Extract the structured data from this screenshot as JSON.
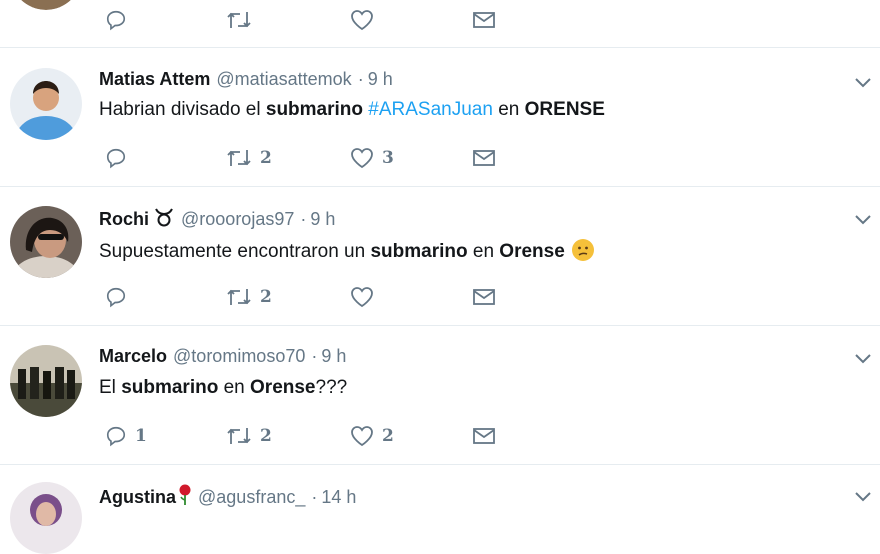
{
  "icons": {
    "reply": "reply-icon",
    "retweet": "retweet-icon",
    "like": "heart-icon",
    "dm": "envelope-icon",
    "more": "chevron-down-icon"
  },
  "colors": {
    "hashtag": "#1da1f2",
    "secondary": "#657786",
    "text": "#14171a",
    "divider": "#e6ecf0"
  },
  "tweets": [
    {
      "name": "",
      "handle": "",
      "time": "",
      "text": "",
      "counts": {
        "reply": "",
        "retweet": "",
        "like": ""
      }
    },
    {
      "name": "Matias Attem",
      "handle": "@matiasattemok",
      "dot": "·",
      "time": "9 h",
      "text_parts": [
        "Habrian divisado el ",
        "submarino",
        " ",
        "#ARASanJuan",
        " en ",
        "ORENSE"
      ],
      "counts": {
        "reply": "",
        "retweet": "2",
        "like": "3"
      }
    },
    {
      "name": "Rochi",
      "name_symbol": "taurus-symbol",
      "handle": "@rooorojas97",
      "dot": "·",
      "time": "9 h",
      "text_parts": [
        "Supuestamente encontraron un ",
        "submarino",
        " en ",
        "Orense"
      ],
      "emoji": "confused-face-emoji",
      "counts": {
        "reply": "",
        "retweet": "2",
        "like": ""
      }
    },
    {
      "name": "Marcelo",
      "handle": "@toromimoso70",
      "dot": "·",
      "time": "9 h",
      "text_parts": [
        "El ",
        "submarino",
        " en ",
        "Orense",
        "???"
      ],
      "counts": {
        "reply": "1",
        "retweet": "2",
        "like": "2"
      }
    },
    {
      "name": "Agustina",
      "name_symbol": "rose-emoji",
      "handle": "@agusfranc_",
      "dot": "·",
      "time": "14 h"
    }
  ]
}
